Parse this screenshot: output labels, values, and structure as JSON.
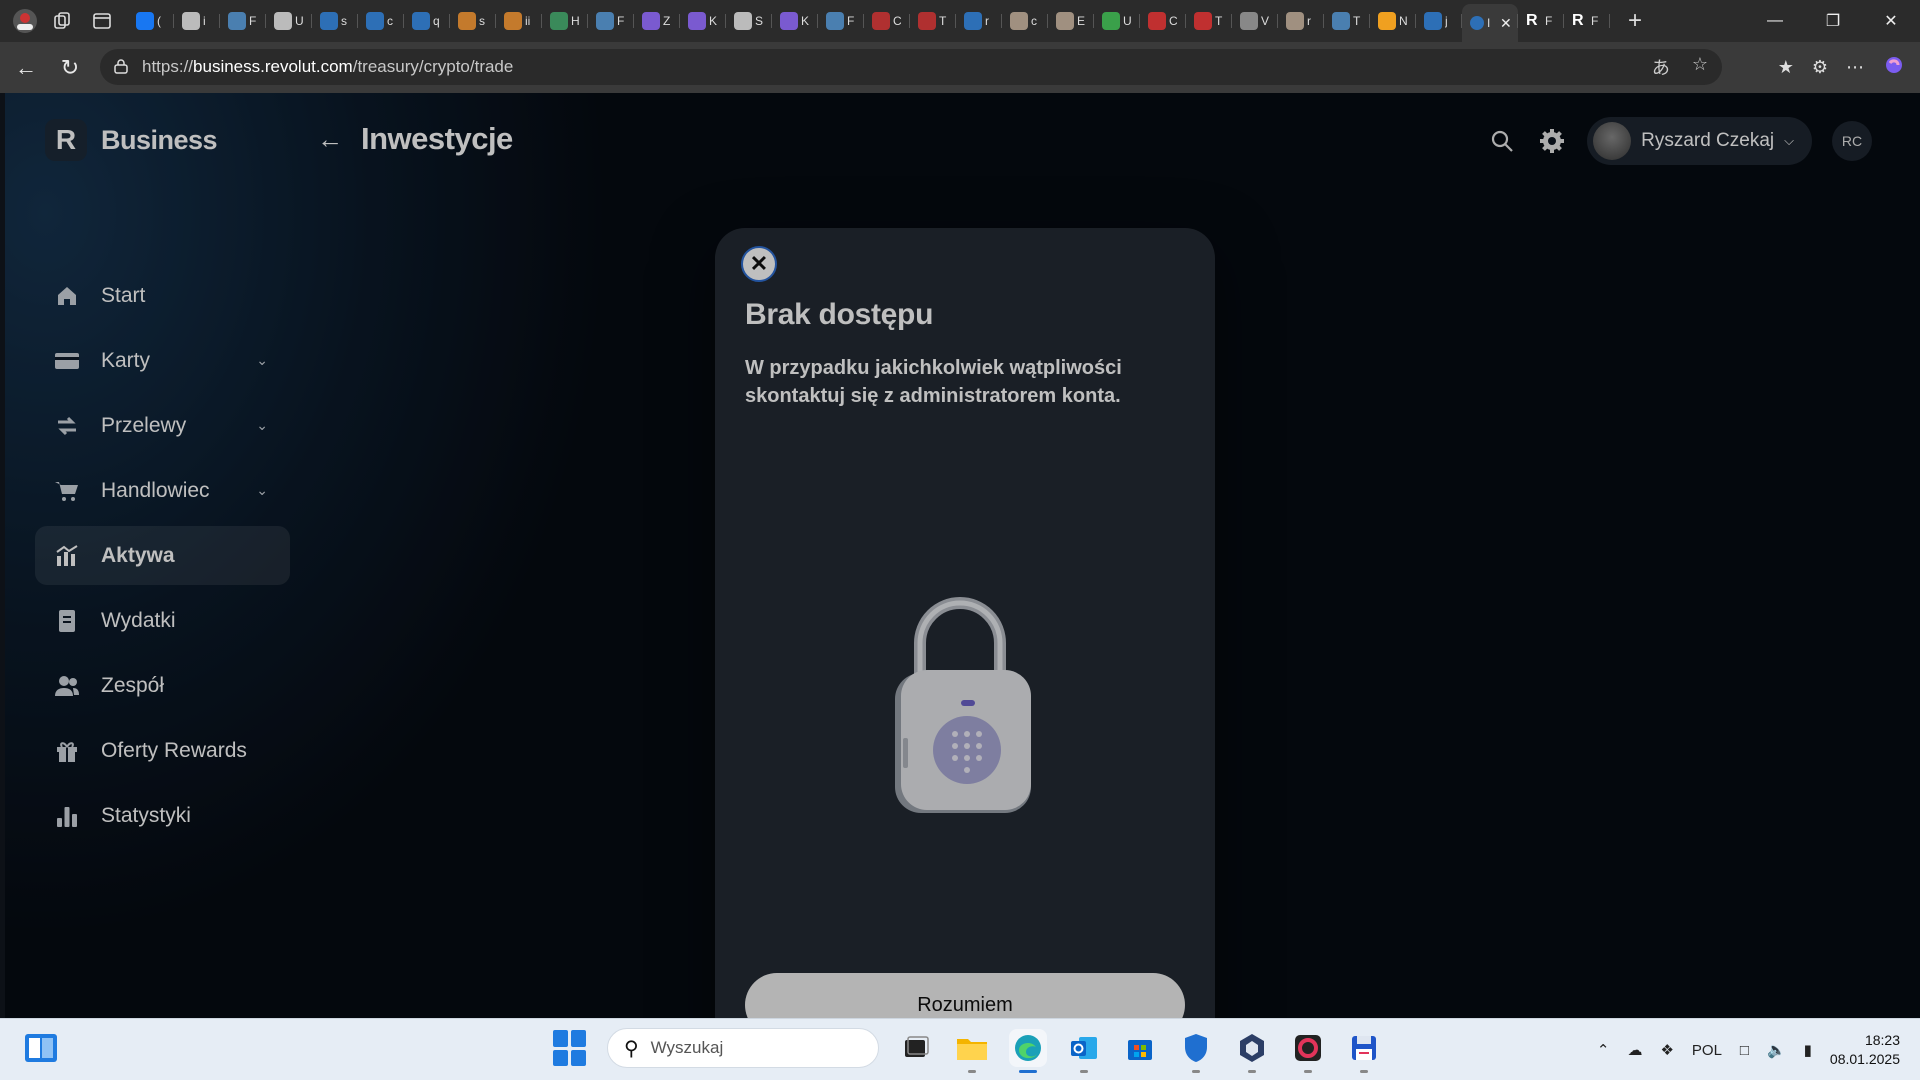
{
  "browser": {
    "tabs": [
      {
        "label": "(",
        "color": "#1877f2"
      },
      {
        "label": "i",
        "color": "#bbbbbb"
      },
      {
        "label": "F",
        "color": "#4a7fb0"
      },
      {
        "label": "U",
        "color": "#bbbbbb"
      },
      {
        "label": "s",
        "color": "#2d6fb6"
      },
      {
        "label": "c",
        "color": "#2d6fb6"
      },
      {
        "label": "q",
        "color": "#2d6fb6"
      },
      {
        "label": "s",
        "color": "#c47a2c"
      },
      {
        "label": "ii",
        "color": "#c47a2c"
      },
      {
        "label": "H",
        "color": "#3a8a5a"
      },
      {
        "label": "F",
        "color": "#4a7fb0"
      },
      {
        "label": "Z",
        "color": "#7a5ad0"
      },
      {
        "label": "K",
        "color": "#7a5ad0"
      },
      {
        "label": "S",
        "color": "#bbbbbb"
      },
      {
        "label": "K",
        "color": "#7a5ad0"
      },
      {
        "label": "F",
        "color": "#4a7fb0"
      },
      {
        "label": "C",
        "color": "#b03030"
      },
      {
        "label": "T",
        "color": "#b03030"
      },
      {
        "label": "r",
        "color": "#2d6fb6"
      },
      {
        "label": "c",
        "color": "#a09080"
      },
      {
        "label": "E",
        "color": "#a09080"
      },
      {
        "label": "U",
        "color": "#3aa04a"
      },
      {
        "label": "C",
        "color": "#c03030"
      },
      {
        "label": "T",
        "color": "#c03030"
      },
      {
        "label": "V",
        "color": "#888888"
      },
      {
        "label": "r",
        "color": "#a09080"
      },
      {
        "label": "T",
        "color": "#4a7fb0"
      },
      {
        "label": "N",
        "color": "#f0a020"
      },
      {
        "label": "j",
        "color": "#2d6fb6"
      }
    ],
    "active_tab": {
      "label": "I",
      "close": "✕"
    },
    "pinned_tabs": [
      {
        "label": "F",
        "icon": "R"
      },
      {
        "label": "F",
        "icon": "R"
      }
    ],
    "new_tab": "+",
    "url_prefix": "https://",
    "url_domain": "business.revolut.com",
    "url_path": "/treasury/crypto/trade"
  },
  "app": {
    "brand_logo": "R",
    "brand_name": "Business",
    "page_title": "Inwestycje",
    "nav": [
      {
        "label": "Start",
        "icon": "home-icon",
        "chevron": false,
        "active": false
      },
      {
        "label": "Karty",
        "icon": "card-icon",
        "chevron": true,
        "active": false
      },
      {
        "label": "Przelewy",
        "icon": "transfer-icon",
        "chevron": true,
        "active": false
      },
      {
        "label": "Handlowiec",
        "icon": "cart-icon",
        "chevron": true,
        "active": false
      },
      {
        "label": "Aktywa",
        "icon": "chart-icon",
        "chevron": false,
        "active": true
      },
      {
        "label": "Wydatki",
        "icon": "receipt-icon",
        "chevron": false,
        "active": false
      },
      {
        "label": "Zespół",
        "icon": "team-icon",
        "chevron": false,
        "active": false
      },
      {
        "label": "Oferty Rewards",
        "icon": "gift-icon",
        "chevron": false,
        "active": false
      },
      {
        "label": "Statystyki",
        "icon": "stats-icon",
        "chevron": false,
        "active": false
      }
    ],
    "user_name": "Ryszard Czekaj",
    "user_initials": "RC"
  },
  "modal": {
    "title": "Brak dostępu",
    "body": "W przypadku jakichkolwiek wątpliwości skontaktuj się z administratorem konta.",
    "cta": "Rozumiem",
    "close": "✕"
  },
  "taskbar": {
    "search_placeholder": "Wyszukaj",
    "language": "POL",
    "time": "18:23",
    "date": "08.01.2025"
  },
  "colors": {
    "accent": "#2f6fd3",
    "modal_bg": "#232a33",
    "cta_bg": "#f0f0f0"
  }
}
